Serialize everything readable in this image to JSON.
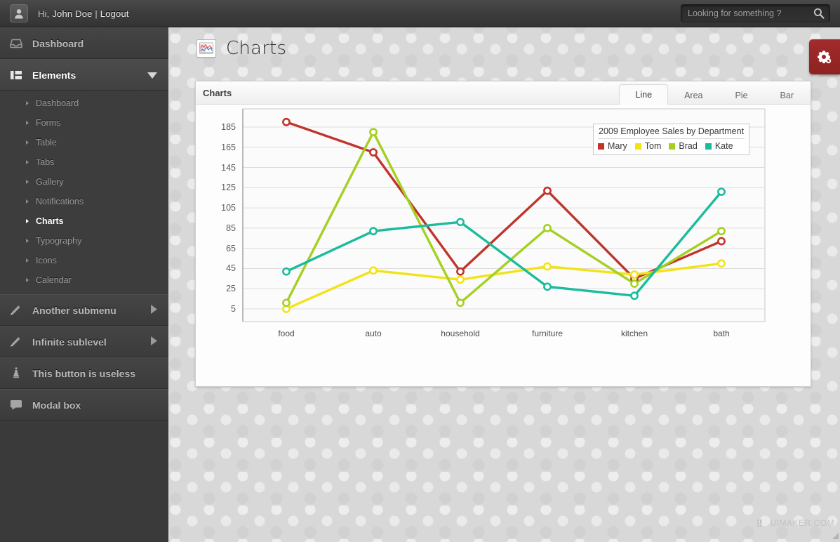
{
  "topbar": {
    "greeting_prefix": "Hi, ",
    "user": "John Doe",
    "separator": " | ",
    "logout": "Logout",
    "avatar_icon": "user-icon",
    "search_placeholder": "Looking for something ?",
    "search_value": "",
    "search_icon": "search-icon"
  },
  "sidebar": {
    "dashboard": {
      "label": "Dashboard",
      "icon": "inbox-icon"
    },
    "elements": {
      "label": "Elements",
      "icon": "layout-icon",
      "caret": "chevron-down-icon",
      "expanded": true
    },
    "sub_items": [
      {
        "label": "Dashboard"
      },
      {
        "label": "Forms"
      },
      {
        "label": "Table"
      },
      {
        "label": "Tabs"
      },
      {
        "label": "Gallery"
      },
      {
        "label": "Notifications"
      },
      {
        "label": "Charts",
        "current": true
      },
      {
        "label": "Typography"
      },
      {
        "label": "Icons"
      },
      {
        "label": "Calendar"
      }
    ],
    "bottom_items": [
      {
        "label": "Another submenu",
        "icon": "brush-icon",
        "caret": "chevron-right-icon"
      },
      {
        "label": "Infinite sublevel",
        "icon": "brush-icon",
        "caret": "chevron-right-icon"
      },
      {
        "label": "This button is useless",
        "icon": "pin-icon",
        "caret": ""
      },
      {
        "label": "Modal box",
        "icon": "comment-icon",
        "caret": ""
      }
    ]
  },
  "page": {
    "title": "Charts",
    "title_icon": "chart-icon",
    "settings_button_icon": "gear-icon"
  },
  "panel": {
    "title": "Charts",
    "tabs": [
      {
        "label": "Line",
        "active": true
      },
      {
        "label": "Area",
        "active": false
      },
      {
        "label": "Pie",
        "active": false
      },
      {
        "label": "Bar",
        "active": false
      }
    ]
  },
  "footer": {
    "watermark": "UIMAKER.COM",
    "watermark_icon": "uimaker-logo-icon"
  },
  "chart_data": {
    "type": "line",
    "title": "2009 Employee Sales by Department",
    "xlabel": "",
    "ylabel": "",
    "categories": [
      "food",
      "auto",
      "household",
      "furniture",
      "kitchen",
      "bath"
    ],
    "yticks": [
      5,
      25,
      45,
      65,
      85,
      105,
      125,
      145,
      165,
      185
    ],
    "ylim": [
      -5,
      195
    ],
    "grid": true,
    "legend_position": "top-right",
    "series": [
      {
        "name": "Mary",
        "color": "#c0342b",
        "values": [
          190,
          160,
          42,
          122,
          35,
          72
        ]
      },
      {
        "name": "Tom",
        "color": "#f2e318",
        "values": [
          5,
          43,
          34,
          47,
          39,
          50
        ]
      },
      {
        "name": "Brad",
        "color": "#a5d022",
        "values": [
          11,
          180,
          11,
          85,
          30,
          82
        ]
      },
      {
        "name": "Kate",
        "color": "#1abc9c",
        "values": [
          42,
          82,
          91,
          27,
          18,
          121
        ]
      }
    ]
  }
}
